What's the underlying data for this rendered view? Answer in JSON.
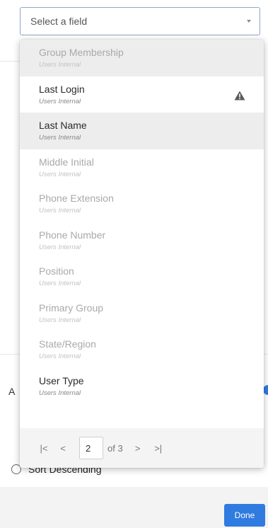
{
  "select": {
    "placeholder": "Select a field"
  },
  "fields": [
    {
      "label": "Group Membership",
      "sub": "Users Internal",
      "enabled": false,
      "highlight": true,
      "warning": false
    },
    {
      "label": "Last Login",
      "sub": "Users Internal",
      "enabled": true,
      "highlight": false,
      "warning": true
    },
    {
      "label": "Last Name",
      "sub": "Users Internal",
      "enabled": true,
      "highlight": true,
      "warning": false
    },
    {
      "label": "Middle Initial",
      "sub": "Users Internal",
      "enabled": false,
      "highlight": false,
      "warning": false
    },
    {
      "label": "Phone Extension",
      "sub": "Users Internal",
      "enabled": false,
      "highlight": false,
      "warning": false
    },
    {
      "label": "Phone Number",
      "sub": "Users Internal",
      "enabled": false,
      "highlight": false,
      "warning": false
    },
    {
      "label": "Position",
      "sub": "Users Internal",
      "enabled": false,
      "highlight": false,
      "warning": false
    },
    {
      "label": "Primary Group",
      "sub": "Users Internal",
      "enabled": false,
      "highlight": false,
      "warning": false
    },
    {
      "label": "State/Region",
      "sub": "Users Internal",
      "enabled": false,
      "highlight": false,
      "warning": false
    },
    {
      "label": "User Type",
      "sub": "Users Internal",
      "enabled": true,
      "highlight": false,
      "warning": false
    }
  ],
  "pagination": {
    "first": "|<",
    "prev": "<",
    "current_page": "2",
    "of_label": "of 3",
    "next": ">",
    "last": ">|"
  },
  "background": {
    "partial_label": "A",
    "sort_descending_label": "Sort Descending",
    "done_label": "Done"
  },
  "colors": {
    "accent": "#2f7be0",
    "warning_icon": "#5a5a5a",
    "highlight_row": "#ededed",
    "pager_bg": "#f4f4f4"
  },
  "icons": {
    "warning": "warning-triangle-icon",
    "caret": "chevron-down-icon"
  }
}
